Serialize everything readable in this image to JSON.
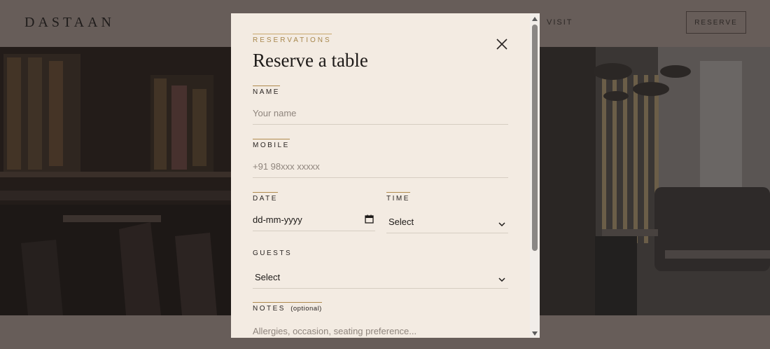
{
  "site": {
    "brand": "DASTAAN",
    "nav_visit": "VISIT",
    "reserve_button": "RESERVE"
  },
  "modal": {
    "eyebrow": "RESERVATIONS",
    "title": "Reserve a table",
    "close_icon": "close-icon",
    "fields": {
      "name": {
        "label": "NAME",
        "placeholder": "Your name"
      },
      "mobile": {
        "label": "MOBILE",
        "placeholder": "+91 98xxx xxxxx"
      },
      "date": {
        "label": "DATE",
        "value": "dd-mm-yyyy",
        "icon": "calendar-icon"
      },
      "time": {
        "label": "TIME",
        "value": "Select"
      },
      "guests": {
        "label": "GUESTS",
        "value": "Select"
      },
      "notes": {
        "label": "NOTES",
        "optional": "(optional)",
        "placeholder": "Allergies, occasion, seating preference..."
      }
    }
  },
  "colors": {
    "modal_bg": "#f3ebe2",
    "accent_gold": "#b08a4e",
    "header_bg": "#675d59"
  }
}
